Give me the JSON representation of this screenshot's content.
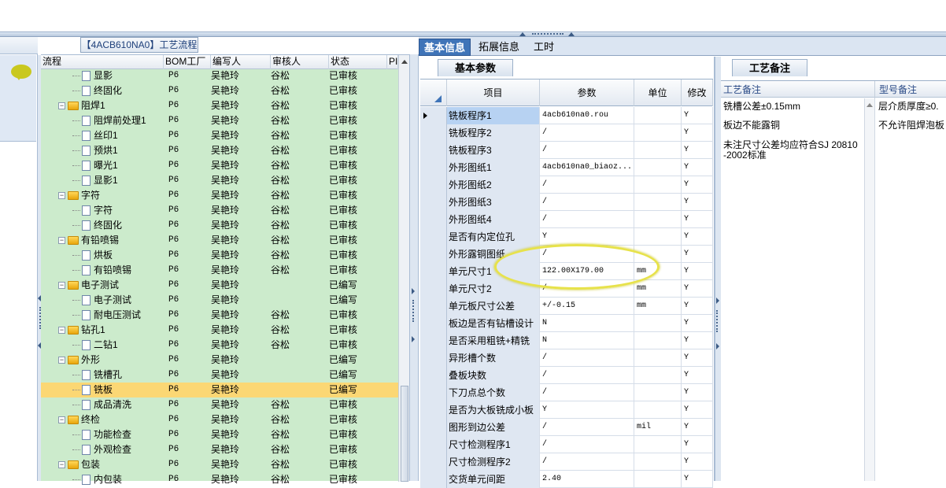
{
  "tree_panel": {
    "title": "【4ACB610NA0】工艺流程",
    "columns": [
      "流程",
      "BOM工厂",
      "编写人",
      "审核人",
      "状态",
      "PI"
    ],
    "rows": [
      {
        "level": 2,
        "type": "doc",
        "name": "显影",
        "bom": "P6",
        "writer": "吴艳玲",
        "reviewer": "谷松",
        "status": "已审核"
      },
      {
        "level": 2,
        "type": "doc",
        "name": "终固化",
        "bom": "P6",
        "writer": "吴艳玲",
        "reviewer": "谷松",
        "status": "已审核"
      },
      {
        "level": 1,
        "type": "folder",
        "name": "阻焊1",
        "bom": "P6",
        "writer": "吴艳玲",
        "reviewer": "谷松",
        "status": "已审核"
      },
      {
        "level": 2,
        "type": "doc",
        "name": "阻焊前处理1",
        "bom": "P6",
        "writer": "吴艳玲",
        "reviewer": "谷松",
        "status": "已审核"
      },
      {
        "level": 2,
        "type": "doc",
        "name": "丝印1",
        "bom": "P6",
        "writer": "吴艳玲",
        "reviewer": "谷松",
        "status": "已审核"
      },
      {
        "level": 2,
        "type": "doc",
        "name": "预烘1",
        "bom": "P6",
        "writer": "吴艳玲",
        "reviewer": "谷松",
        "status": "已审核"
      },
      {
        "level": 2,
        "type": "doc",
        "name": "曝光1",
        "bom": "P6",
        "writer": "吴艳玲",
        "reviewer": "谷松",
        "status": "已审核"
      },
      {
        "level": 2,
        "type": "doc",
        "name": "显影1",
        "bom": "P6",
        "writer": "吴艳玲",
        "reviewer": "谷松",
        "status": "已审核"
      },
      {
        "level": 1,
        "type": "folder",
        "name": "字符",
        "bom": "P6",
        "writer": "吴艳玲",
        "reviewer": "谷松",
        "status": "已审核"
      },
      {
        "level": 2,
        "type": "doc",
        "name": "字符",
        "bom": "P6",
        "writer": "吴艳玲",
        "reviewer": "谷松",
        "status": "已审核"
      },
      {
        "level": 2,
        "type": "doc",
        "name": "终固化",
        "bom": "P6",
        "writer": "吴艳玲",
        "reviewer": "谷松",
        "status": "已审核"
      },
      {
        "level": 1,
        "type": "folder",
        "name": "有铅喷锡",
        "bom": "P6",
        "writer": "吴艳玲",
        "reviewer": "谷松",
        "status": "已审核"
      },
      {
        "level": 2,
        "type": "doc",
        "name": "烘板",
        "bom": "P6",
        "writer": "吴艳玲",
        "reviewer": "谷松",
        "status": "已审核"
      },
      {
        "level": 2,
        "type": "doc",
        "name": "有铅喷锡",
        "bom": "P6",
        "writer": "吴艳玲",
        "reviewer": "谷松",
        "status": "已审核"
      },
      {
        "level": 1,
        "type": "folder",
        "name": "电子测试",
        "bom": "P6",
        "writer": "吴艳玲",
        "reviewer": "",
        "status": "已编写"
      },
      {
        "level": 2,
        "type": "doc",
        "name": "电子测试",
        "bom": "P6",
        "writer": "吴艳玲",
        "reviewer": "",
        "status": "已编写"
      },
      {
        "level": 2,
        "type": "doc",
        "name": "耐电压测试",
        "bom": "P6",
        "writer": "吴艳玲",
        "reviewer": "谷松",
        "status": "已审核"
      },
      {
        "level": 1,
        "type": "folder",
        "name": "钻孔1",
        "bom": "P6",
        "writer": "吴艳玲",
        "reviewer": "谷松",
        "status": "已审核"
      },
      {
        "level": 2,
        "type": "doc",
        "name": "二钻1",
        "bom": "P6",
        "writer": "吴艳玲",
        "reviewer": "谷松",
        "status": "已审核"
      },
      {
        "level": 1,
        "type": "folder",
        "name": "外形",
        "bom": "P6",
        "writer": "吴艳玲",
        "reviewer": "",
        "status": "已编写"
      },
      {
        "level": 2,
        "type": "doc",
        "name": "铣槽孔",
        "bom": "P6",
        "writer": "吴艳玲",
        "reviewer": "",
        "status": "已编写"
      },
      {
        "level": 2,
        "type": "doc",
        "name": "铣板",
        "bom": "P6",
        "writer": "吴艳玲",
        "reviewer": "",
        "status": "已编写",
        "selected": true
      },
      {
        "level": 2,
        "type": "doc",
        "name": "成品清洗",
        "bom": "P6",
        "writer": "吴艳玲",
        "reviewer": "谷松",
        "status": "已审核"
      },
      {
        "level": 1,
        "type": "folder",
        "name": "终检",
        "bom": "P6",
        "writer": "吴艳玲",
        "reviewer": "谷松",
        "status": "已审核"
      },
      {
        "level": 2,
        "type": "doc",
        "name": "功能检查",
        "bom": "P6",
        "writer": "吴艳玲",
        "reviewer": "谷松",
        "status": "已审核"
      },
      {
        "level": 2,
        "type": "doc",
        "name": "外观检查",
        "bom": "P6",
        "writer": "吴艳玲",
        "reviewer": "谷松",
        "status": "已审核"
      },
      {
        "level": 1,
        "type": "folder",
        "name": "包装",
        "bom": "P6",
        "writer": "吴艳玲",
        "reviewer": "谷松",
        "status": "已审核"
      },
      {
        "level": 2,
        "type": "doc",
        "name": "内包装",
        "bom": "P6",
        "writer": "吴艳玲",
        "reviewer": "谷松",
        "status": "已审核"
      }
    ]
  },
  "tabs": [
    "基本信息",
    "拓展信息",
    "工时"
  ],
  "basic_params": {
    "section_title": "基本参数",
    "columns": [
      "项目",
      "参数",
      "单位",
      "修改"
    ],
    "rows": [
      {
        "item": "铣板程序1",
        "param": "4acb610na0.rou",
        "unit": "",
        "mod": "Y",
        "current": true
      },
      {
        "item": "铣板程序2",
        "param": "/",
        "unit": "",
        "mod": "Y"
      },
      {
        "item": "铣板程序3",
        "param": "/",
        "unit": "",
        "mod": "Y"
      },
      {
        "item": "外形图纸1",
        "param": "4acb610na0_biaoz...",
        "unit": "",
        "mod": "Y"
      },
      {
        "item": "外形图纸2",
        "param": "/",
        "unit": "",
        "mod": "Y"
      },
      {
        "item": "外形图纸3",
        "param": "/",
        "unit": "",
        "mod": "Y"
      },
      {
        "item": "外形图纸4",
        "param": "/",
        "unit": "",
        "mod": "Y"
      },
      {
        "item": "是否有内定位孔",
        "param": "Y",
        "unit": "",
        "mod": "Y"
      },
      {
        "item": "外形露铜图纸",
        "param": "/",
        "unit": "",
        "mod": "Y"
      },
      {
        "item": "单元尺寸1",
        "param": "122.00X179.00",
        "unit": "mm",
        "mod": "Y"
      },
      {
        "item": "单元尺寸2",
        "param": "/",
        "unit": "mm",
        "mod": "Y"
      },
      {
        "item": "单元板尺寸公差",
        "param": "+/-0.15",
        "unit": "mm",
        "mod": "Y"
      },
      {
        "item": "板边是否有钻槽设计",
        "param": "N",
        "unit": "",
        "mod": "Y"
      },
      {
        "item": "是否采用粗铣+精铣",
        "param": "N",
        "unit": "",
        "mod": "Y"
      },
      {
        "item": "异形槽个数",
        "param": "/",
        "unit": "",
        "mod": "Y"
      },
      {
        "item": "叠板块数",
        "param": "/",
        "unit": "",
        "mod": "Y"
      },
      {
        "item": "下刀点总个数",
        "param": "/",
        "unit": "",
        "mod": "Y"
      },
      {
        "item": "是否为大板铣成小板",
        "param": "Y",
        "unit": "",
        "mod": "Y"
      },
      {
        "item": "图形到边公差",
        "param": "/",
        "unit": "mil",
        "mod": "Y"
      },
      {
        "item": "尺寸检测程序1",
        "param": "/",
        "unit": "",
        "mod": "Y"
      },
      {
        "item": "尺寸检测程序2",
        "param": "/",
        "unit": "",
        "mod": "Y"
      },
      {
        "item": "交货单元间距",
        "param": "2.40",
        "unit": "",
        "mod": "Y"
      }
    ]
  },
  "process_notes": {
    "section_title": "工艺备注",
    "columns": [
      "工艺备注",
      "型号备注"
    ],
    "notes": [
      "铣槽公差±0.15mm",
      "板边不能露铜",
      "未注尺寸公差均应符合SJ 20810",
      "-2002标准"
    ],
    "model_notes": [
      "层介质厚度≥0.",
      "不允许阻焊泡板"
    ]
  }
}
